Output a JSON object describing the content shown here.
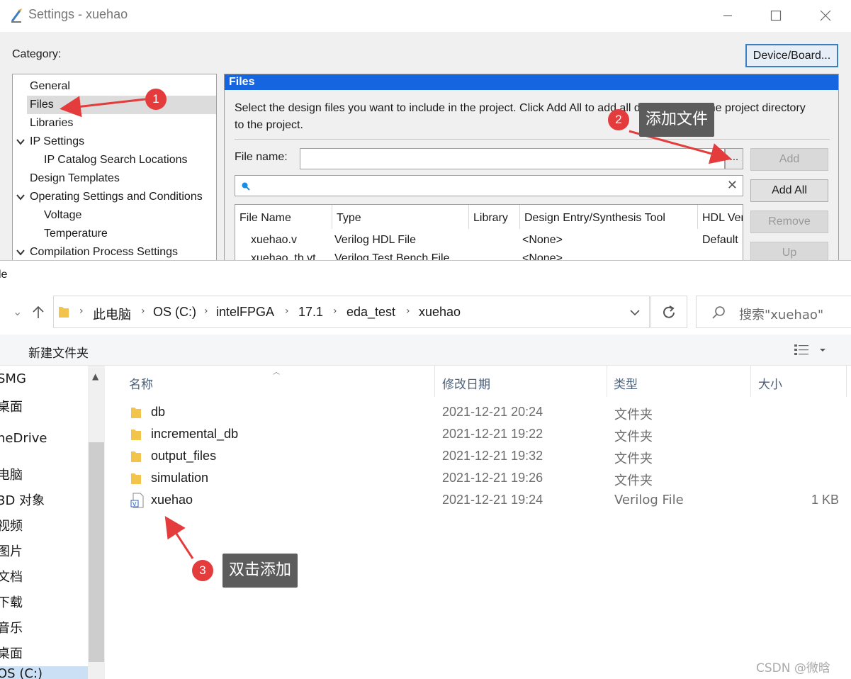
{
  "settings": {
    "title": "Settings - xuehao",
    "category_label": "Category:",
    "device_button": "Device/Board...",
    "tree": [
      {
        "label": "General",
        "indent": 0,
        "chevron": false,
        "selected": false
      },
      {
        "label": "Files",
        "indent": 0,
        "chevron": false,
        "selected": true
      },
      {
        "label": "Libraries",
        "indent": 0,
        "chevron": false,
        "selected": false
      },
      {
        "label": "IP Settings",
        "indent": 0,
        "chevron": true,
        "selected": false
      },
      {
        "label": "IP Catalog Search Locations",
        "indent": 1,
        "chevron": false,
        "selected": false
      },
      {
        "label": "Design Templates",
        "indent": 0,
        "chevron": false,
        "selected": false
      },
      {
        "label": "Operating Settings and Conditions",
        "indent": 0,
        "chevron": true,
        "selected": false
      },
      {
        "label": "Voltage",
        "indent": 1,
        "chevron": false,
        "selected": false
      },
      {
        "label": "Temperature",
        "indent": 1,
        "chevron": false,
        "selected": false
      },
      {
        "label": "Compilation Process Settings",
        "indent": 0,
        "chevron": true,
        "selected": false
      }
    ],
    "files": {
      "header": "Files",
      "description": "Select the design files you want to include in the project. Click Add All to add all design files in the project directory to the project.",
      "file_name_label": "File name:",
      "file_name_value": "",
      "browse_label": "...",
      "buttons": {
        "add": "Add",
        "add_all": "Add All",
        "remove": "Remove",
        "up": "Up"
      },
      "columns": [
        "File Name",
        "Type",
        "Library",
        "Design Entry/Synthesis Tool",
        "HDL Version"
      ],
      "rows": [
        [
          "xuehao.v",
          "Verilog HDL File",
          "",
          "<None>",
          "Default"
        ],
        [
          "xuehao_tb.vt",
          "Verilog Test Bench File",
          "",
          "<None>",
          ""
        ]
      ]
    }
  },
  "chooser": {
    "title": "le",
    "breadcrumb": [
      "此电脑",
      "OS (C:)",
      "intelFPGA",
      "17.1",
      "eda_test",
      "xuehao"
    ],
    "search_placeholder": "搜索\"xuehao\"",
    "new_folder": "新建文件夹",
    "nav_items": [
      "SMG",
      "桌面",
      "neDrive",
      "电脑",
      "3D 对象",
      "视频",
      "图片",
      "文档",
      "下载",
      "音乐",
      "桌面",
      "OS (C:)"
    ],
    "columns": {
      "name": "名称",
      "modified": "修改日期",
      "type": "类型",
      "size": "大小"
    },
    "files": [
      {
        "name": "db",
        "modified": "2021-12-21 20:24",
        "type": "文件夹",
        "size": "",
        "icon": "folder-icon"
      },
      {
        "name": "incremental_db",
        "modified": "2021-12-21 19:22",
        "type": "文件夹",
        "size": "",
        "icon": "folder-icon"
      },
      {
        "name": "output_files",
        "modified": "2021-12-21 19:32",
        "type": "文件夹",
        "size": "",
        "icon": "folder-icon"
      },
      {
        "name": "simulation",
        "modified": "2021-12-21 19:26",
        "type": "文件夹",
        "size": "",
        "icon": "folder-icon"
      },
      {
        "name": "xuehao",
        "modified": "2021-12-21 19:24",
        "type": "Verilog File",
        "size": "1 KB",
        "icon": "verilog-file-icon"
      }
    ]
  },
  "annotations": [
    {
      "number": "1",
      "label": ""
    },
    {
      "number": "2",
      "label": "添加文件"
    },
    {
      "number": "3",
      "label": "双击添加"
    }
  ],
  "watermark": "CSDN @微晗",
  "colors": {
    "files_header": "#1565e0",
    "annotation": "#e43c3c",
    "tag": "#5c5c5c"
  }
}
